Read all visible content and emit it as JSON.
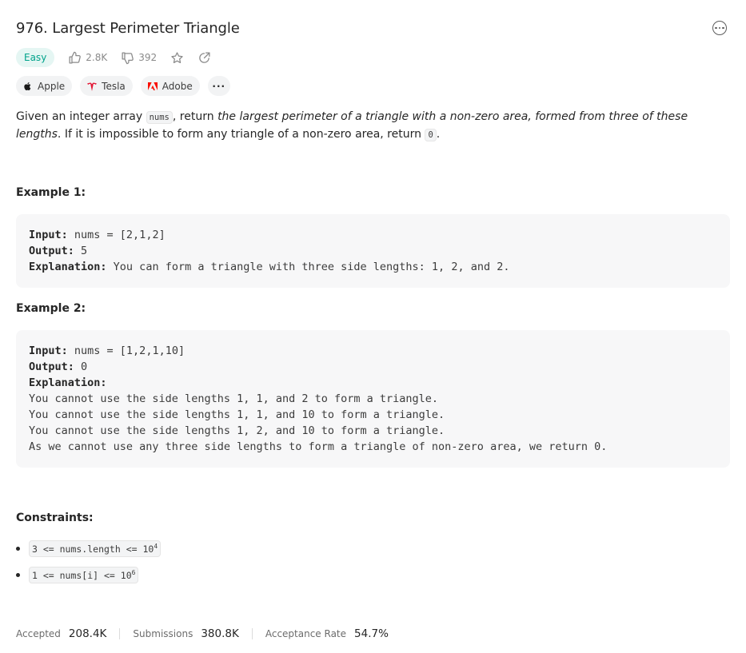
{
  "problem": {
    "title": "976. Largest Perimeter Triangle",
    "difficulty": "Easy",
    "likes": "2.8K",
    "dislikes": "392"
  },
  "companies": [
    {
      "name": "Apple",
      "icon": "apple-logo-icon"
    },
    {
      "name": "Tesla",
      "icon": "tesla-logo-icon"
    },
    {
      "name": "Adobe",
      "icon": "adobe-logo-icon"
    }
  ],
  "more_companies_label": "···",
  "description": {
    "p1": "Given an integer array ",
    "code_nums": "nums",
    "p2": ", return ",
    "italic": "the largest perimeter of a triangle with a non-zero area, formed from three of these lengths",
    "p3": ". If it is impossible to form any triangle of a non-zero area, return ",
    "code_zero": "0",
    "p4": "."
  },
  "examples": [
    {
      "heading": "Example 1:",
      "input_label": "Input:",
      "input": " nums = [2,1,2]",
      "output_label": "Output:",
      "output": " 5",
      "explanation_label": "Explanation:",
      "explanation": " You can form a triangle with three side lengths: 1, 2, and 2."
    },
    {
      "heading": "Example 2:",
      "input_label": "Input:",
      "input": " nums = [1,2,1,10]",
      "output_label": "Output:",
      "output": " 0",
      "explanation_label": "Explanation:",
      "explanation_lines": [
        "You cannot use the side lengths 1, 1, and 2 to form a triangle.",
        "You cannot use the side lengths 1, 1, and 10 to form a triangle.",
        "You cannot use the side lengths 1, 2, and 10 to form a triangle.",
        "As we cannot use any three side lengths to form a triangle of non-zero area, we return 0."
      ]
    }
  ],
  "constraints": {
    "heading": "Constraints:",
    "items": [
      {
        "text": "3 <= nums.length <= 10",
        "sup": "4"
      },
      {
        "text": "1 <= nums[i] <= 10",
        "sup": "6"
      }
    ]
  },
  "stats": {
    "accepted_label": "Accepted",
    "accepted": "208.4K",
    "submissions_label": "Submissions",
    "submissions": "380.8K",
    "rate_label": "Acceptance Rate",
    "rate": "54.7%"
  },
  "colors": {
    "easy_text": "#00a38b",
    "easy_bg": "#e5f6f3",
    "tesla": "#e31937",
    "adobe": "#fa0f00"
  }
}
